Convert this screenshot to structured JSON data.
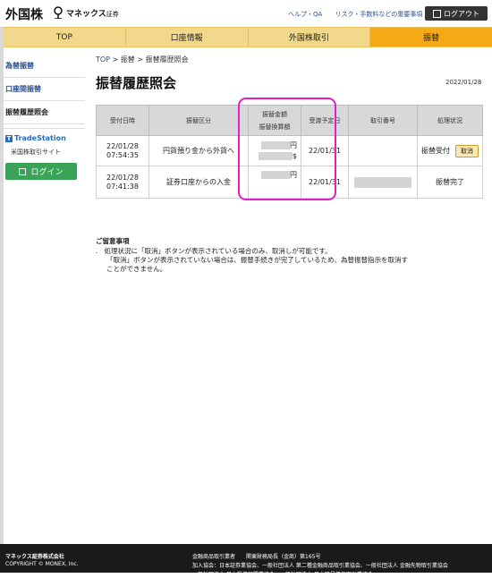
{
  "header": {
    "site_title": "外国株",
    "logo_text": "マネックス",
    "logo_sub": "証券",
    "help_link": "ヘルプ・QA",
    "risk_link": "リスク・手数料などの重要事項",
    "logout_label": "ログアウト"
  },
  "nav": {
    "top": "TOP",
    "account": "口座情報",
    "trade": "外国株取引",
    "transfer": "振替"
  },
  "sidebar": {
    "items": [
      "為替振替",
      "口座間振替",
      "振替履歴照会"
    ],
    "tradestation": {
      "logo": "TradeStation",
      "subtitle": "米国株取引サイト",
      "login_label": "ログイン"
    }
  },
  "breadcrumb": {
    "top": "TOP",
    "sep1": " > ",
    "mid": "振替",
    "sep2": " > ",
    "current": "振替履歴照会"
  },
  "page_title": "振替履歴照会",
  "date": "2022/01/28",
  "table": {
    "headers": {
      "received": "受付日時",
      "type": "振替区分",
      "amount_line1": "振替金額",
      "amount_line2": "振替換算額",
      "scheduled": "受渡予定日",
      "txn_no": "取引番号",
      "status": "処理状況"
    },
    "rows": [
      {
        "date": "22/01/28",
        "time": "07:54:35",
        "type": "円貨預り金から外貨へ",
        "unit1": "円",
        "unit2": "$",
        "scheduled": "22/01/31",
        "status": "振替受付",
        "action": "取消"
      },
      {
        "date": "22/01/28",
        "time": "07:41:38",
        "type": "証券口座からの入金",
        "unit1": "円",
        "scheduled": "22/01/31",
        "status": "振替完了"
      }
    ]
  },
  "notes": {
    "title": "ご留意事項",
    "item1": "処理状況に「取消」ボタンが表示されている場合のみ、取消しが可能です。",
    "item2": "「取消」ボタンが表示されていない場合は、振替手続きが完了しているため、為替振替指示を取消す",
    "item3": "ことができません。"
  },
  "footer": {
    "company": "マネックス証券株式会社",
    "copyright": "COPYRIGHT © MONEX, Inc.",
    "registration": "金融商品取引業者　　関東財務局長（金商）第165号",
    "associations": "加入協会：日本証券業協会、一般社団法人 第二種金融商品取引業協会、一般社団法人 金融先物取引業協会",
    "associations2": "一般社団法人 日本投資顧問業協会、一般社団法人 日本暗号資産取引業協会"
  },
  "colors": {
    "nav_bg": "#f2d88a",
    "nav_active": "#f5a914",
    "link": "#2a4f8f",
    "login_green": "#3aa357",
    "highlight": "#e020c8",
    "footer_bg": "#1a1a1a"
  }
}
